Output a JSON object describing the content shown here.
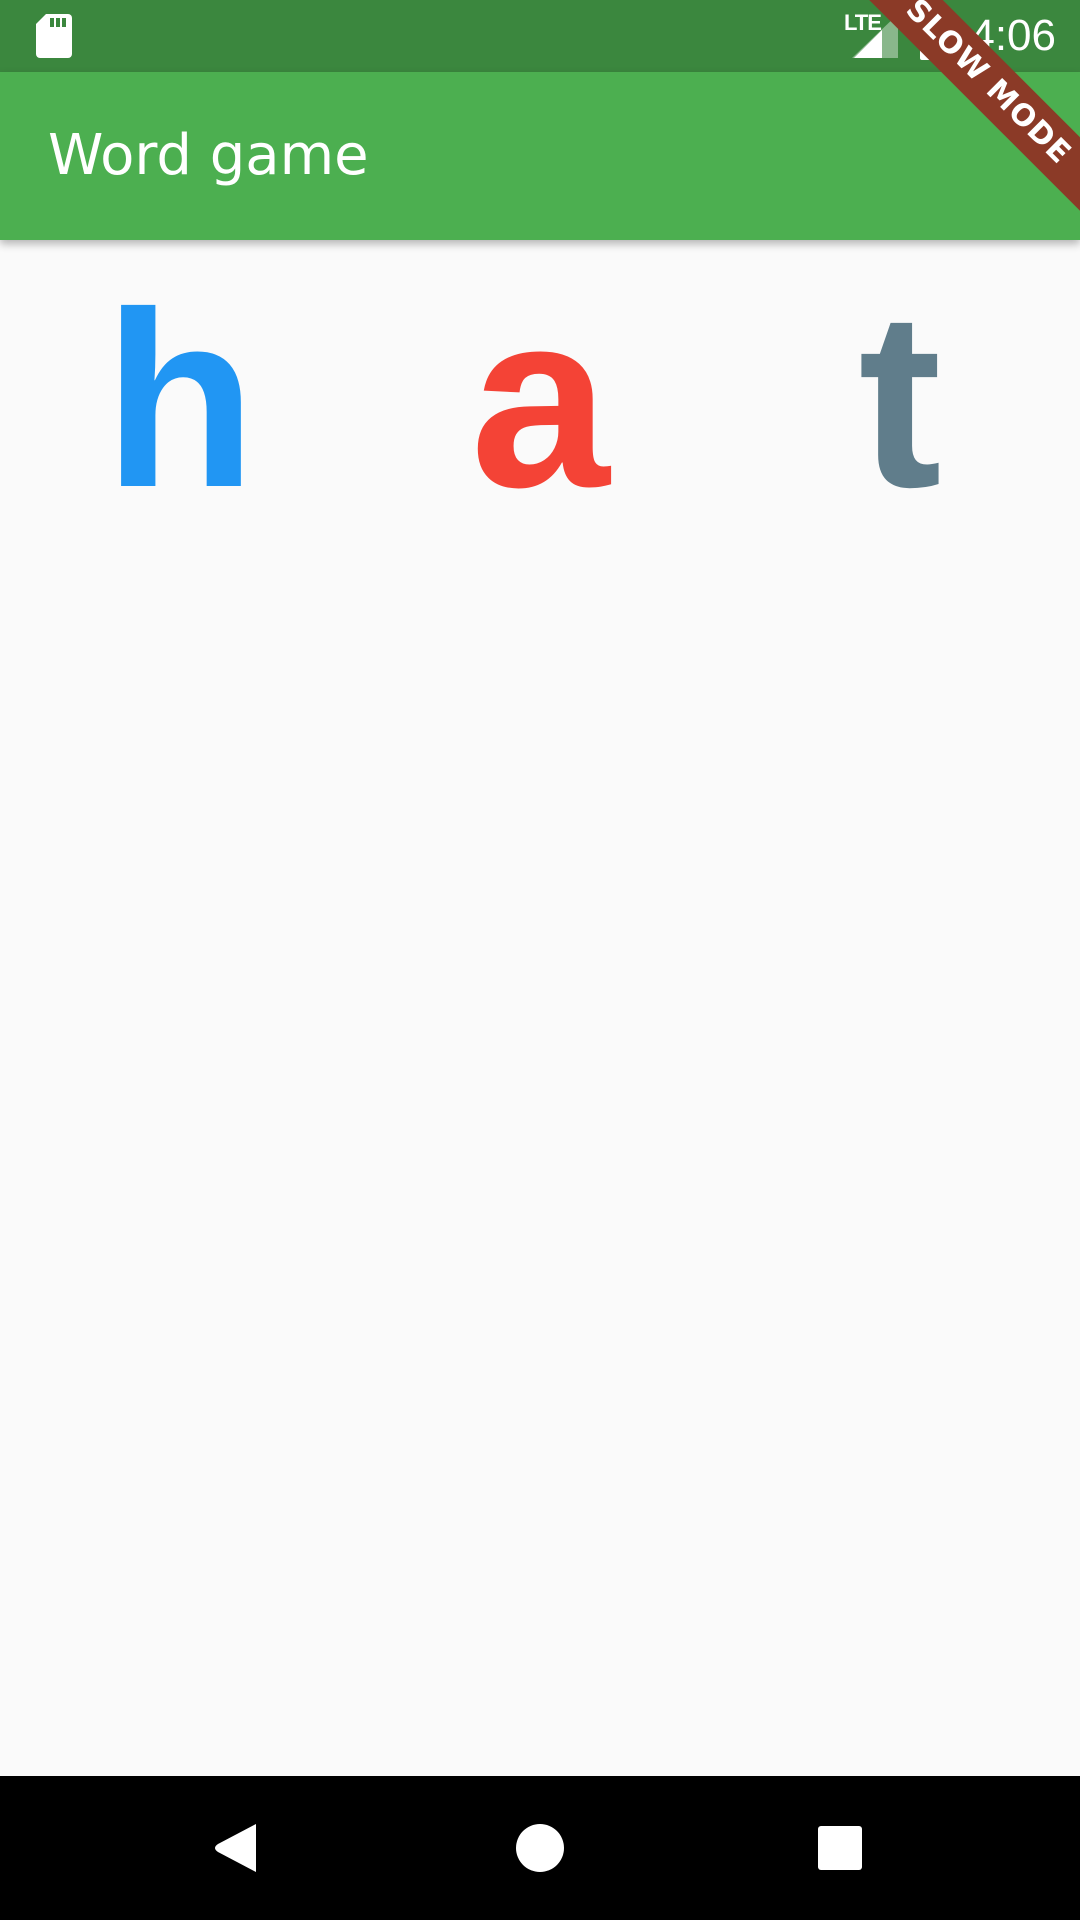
{
  "status_bar": {
    "time": "4:06",
    "network_label": "LTE",
    "icons": [
      "sd-card-icon",
      "signal-icon",
      "battery-charging-icon"
    ]
  },
  "app_bar": {
    "title": "Word game"
  },
  "debug_banner": {
    "label": "SLOW MODE",
    "color": "#8b3a27"
  },
  "word": {
    "letters": [
      {
        "char": "h",
        "color": "#2196f3"
      },
      {
        "char": "a",
        "color": "#f44336"
      },
      {
        "char": "t",
        "color": "#607d8b"
      }
    ]
  },
  "nav_bar": {
    "icons": [
      "back-icon",
      "home-icon",
      "recents-icon"
    ]
  },
  "colors": {
    "status_bar": "#3b873e",
    "app_bar": "#4caf50",
    "background": "#fafafa"
  }
}
